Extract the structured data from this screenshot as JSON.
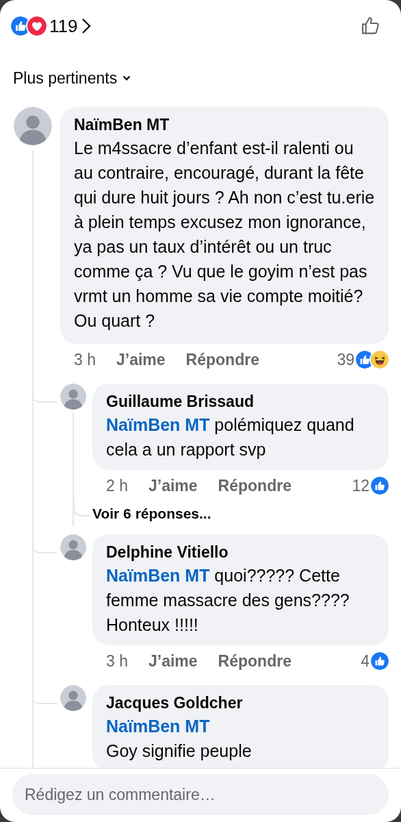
{
  "header": {
    "reactions": [
      {
        "kind": "like"
      },
      {
        "kind": "love"
      }
    ],
    "reaction_count": "119"
  },
  "sort": {
    "label": "Plus pertinents"
  },
  "comments": [
    {
      "author": "NaïmBen MT",
      "text": "Le m4ssacre d’enfant est-il ralenti ou au contraire, encouragé, durant la fête qui dure huit jours ? Ah non c’est tu.erie à plein temps excusez mon ignorance, ya pas un taux d’intérêt ou un truc comme ça ? Vu que le goyim n’est pas vrmt un homme sa vie compte moitié? Ou quart ?",
      "time": "3 h",
      "like_label": "J’aime",
      "reply_label": "Répondre",
      "reaction_count": "39",
      "reactions": [
        {
          "kind": "like"
        },
        {
          "kind": "haha"
        }
      ],
      "replies": [
        {
          "author": "Guillaume Brissaud",
          "mention": "NaïmBen MT",
          "mention_break": false,
          "text": "polémiquez quand cela a un rapport svp",
          "time": "2 h",
          "like_label": "J’aime",
          "reply_label": "Répondre",
          "reaction_count": "12",
          "reactions": [
            {
              "kind": "like"
            }
          ],
          "more_replies": "Voir 6 réponses..."
        },
        {
          "author": "Delphine Vitiello",
          "mention": "NaïmBen MT",
          "mention_break": false,
          "text": "quoi????? Cette femme massacre des gens???? Honteux !!!!!",
          "time": "3 h",
          "like_label": "J’aime",
          "reply_label": "Répondre",
          "reaction_count": "4",
          "reactions": [
            {
              "kind": "like"
            }
          ]
        },
        {
          "author": "Jacques Goldcher",
          "mention": "NaïmBen MT",
          "mention_break": true,
          "text": "Goy signifie peuple"
        }
      ]
    }
  ],
  "composer": {
    "placeholder": "Rédigez un commentaire…"
  }
}
